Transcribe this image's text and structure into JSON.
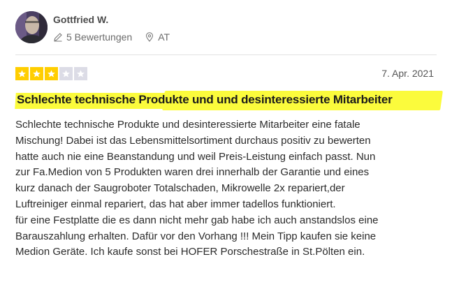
{
  "reviewer": {
    "name": "Gottfried W.",
    "reviews_count": "5 Bewertungen",
    "country": "AT",
    "avatar_icon": "user-photo"
  },
  "review": {
    "rating": 3,
    "max_rating": 5,
    "date": "7. Apr. 2021",
    "title": "Schlechte technische Produkte und und desinteressierte Mitarbeiter",
    "body_lines": [
      "Schlechte technische Produkte und desinteressierte Mitarbeiter eine fatale",
      "Mischung! Dabei ist das Lebensmittelsortiment durchaus positiv zu bewerten",
      "hatte auch nie eine Beanstandung und weil Preis-Leistung einfach passt. Nun",
      "zur Fa.Medion von 5 Produkten waren drei innerhalb der Garantie und eines",
      "kurz danach der Saugroboter Totalschaden, Mikrowelle 2x repariert,der",
      "Luftreiniger einmal repariert, das hat aber immer tadellos funktioniert.",
      "für eine Festplatte die es dann nicht mehr gab habe ich auch anstandslos eine",
      "Barauszahlung erhalten. Dafür vor den Vorhang !!! Mein Tipp kaufen sie keine",
      "Medion Geräte. Ich kaufe sonst bei HOFER Porschestraße in St.Pölten ein."
    ]
  },
  "colors": {
    "star_on": "#ffce00",
    "star_off": "#dcdce6",
    "highlight": "#fbfb3c",
    "divider": "#e3e3e3"
  }
}
